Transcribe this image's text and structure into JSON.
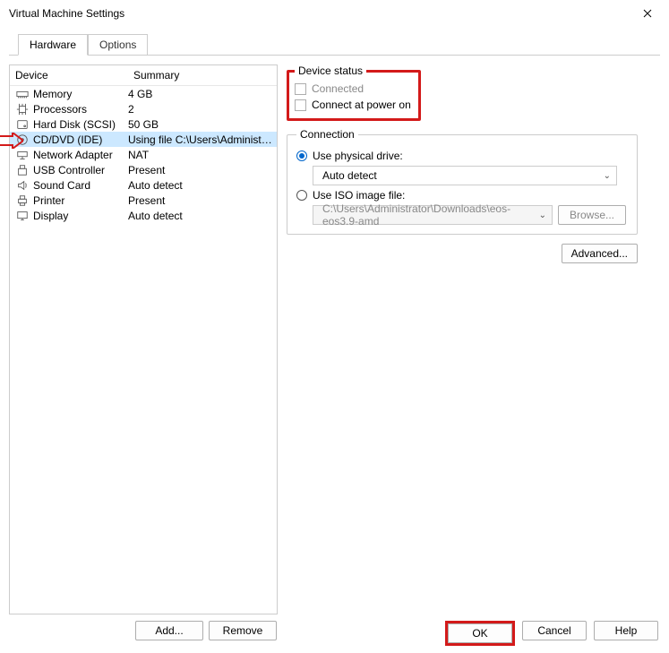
{
  "window": {
    "title": "Virtual Machine Settings"
  },
  "tabs": {
    "hardware": "Hardware",
    "options": "Options"
  },
  "columns": {
    "device": "Device",
    "summary": "Summary"
  },
  "devices": [
    {
      "icon": "memory-icon",
      "name": "Memory",
      "summary": "4 GB"
    },
    {
      "icon": "cpu-icon",
      "name": "Processors",
      "summary": "2"
    },
    {
      "icon": "hdd-icon",
      "name": "Hard Disk (SCSI)",
      "summary": "50 GB"
    },
    {
      "icon": "cd-icon",
      "name": "CD/DVD (IDE)",
      "summary": "Using file C:\\Users\\Administr..."
    },
    {
      "icon": "network-icon",
      "name": "Network Adapter",
      "summary": "NAT"
    },
    {
      "icon": "usb-icon",
      "name": "USB Controller",
      "summary": "Present"
    },
    {
      "icon": "sound-icon",
      "name": "Sound Card",
      "summary": "Auto detect"
    },
    {
      "icon": "printer-icon",
      "name": "Printer",
      "summary": "Present"
    },
    {
      "icon": "display-icon",
      "name": "Display",
      "summary": "Auto detect"
    }
  ],
  "left_buttons": {
    "add": "Add...",
    "remove": "Remove"
  },
  "device_status": {
    "legend": "Device status",
    "connected": "Connected",
    "connect_at_power_on": "Connect at power on"
  },
  "connection": {
    "legend": "Connection",
    "use_physical": "Use physical drive:",
    "physical_value": "Auto detect",
    "use_iso": "Use ISO image file:",
    "iso_value": "C:\\Users\\Administrator\\Downloads\\eos-eos3.9-amd",
    "browse": "Browse..."
  },
  "advanced": "Advanced...",
  "footer": {
    "ok": "OK",
    "cancel": "Cancel",
    "help": "Help"
  }
}
